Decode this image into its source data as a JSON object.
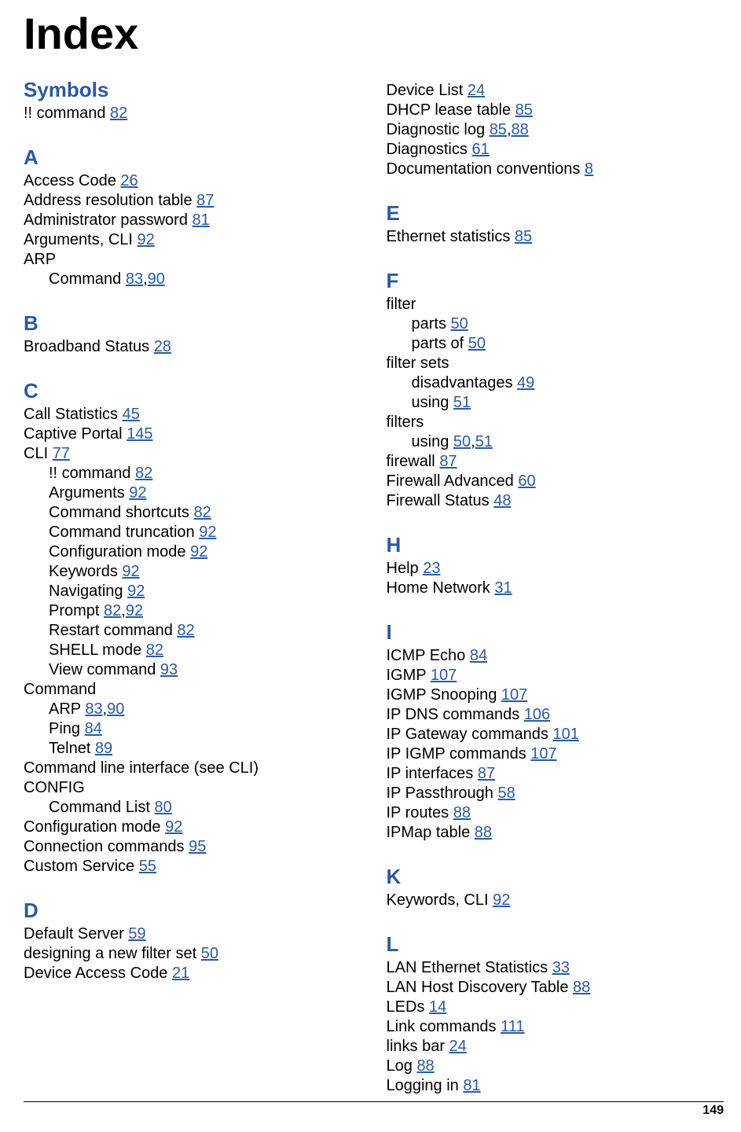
{
  "pageTitle": "Index",
  "pageNumber": "149",
  "columns": [
    [
      {
        "letter": "Symbols",
        "entries": [
          {
            "level": "top",
            "term": "!! command",
            "pages": [
              "82"
            ]
          }
        ]
      },
      {
        "letter": "A",
        "entries": [
          {
            "level": "top",
            "term": "Access Code",
            "pages": [
              "26"
            ]
          },
          {
            "level": "top",
            "term": "Address resolution table",
            "pages": [
              "87"
            ]
          },
          {
            "level": "top",
            "term": "Administrator password",
            "pages": [
              "81"
            ]
          },
          {
            "level": "top",
            "term": "Arguments, CLI",
            "pages": [
              "92"
            ]
          },
          {
            "level": "top",
            "term": "ARP",
            "pages": []
          },
          {
            "level": "sub",
            "term": "Command",
            "pages": [
              "83",
              "90"
            ]
          }
        ]
      },
      {
        "letter": "B",
        "entries": [
          {
            "level": "top",
            "term": "Broadband Status",
            "pages": [
              "28"
            ]
          }
        ]
      },
      {
        "letter": "C",
        "entries": [
          {
            "level": "top",
            "term": "Call Statistics",
            "pages": [
              "45"
            ]
          },
          {
            "level": "top",
            "term": "Captive Portal",
            "pages": [
              "145"
            ]
          },
          {
            "level": "top",
            "term": "CLI",
            "pages": [
              "77"
            ]
          },
          {
            "level": "sub",
            "term": "!! command",
            "pages": [
              "82"
            ]
          },
          {
            "level": "sub",
            "term": "Arguments",
            "pages": [
              "92"
            ]
          },
          {
            "level": "sub",
            "term": "Command shortcuts",
            "pages": [
              "82"
            ]
          },
          {
            "level": "sub",
            "term": "Command truncation",
            "pages": [
              "92"
            ]
          },
          {
            "level": "sub",
            "term": "Configuration mode",
            "pages": [
              "92"
            ]
          },
          {
            "level": "sub",
            "term": "Keywords",
            "pages": [
              "92"
            ]
          },
          {
            "level": "sub",
            "term": "Navigating",
            "pages": [
              "92"
            ]
          },
          {
            "level": "sub",
            "term": "Prompt",
            "pages": [
              "82",
              "92"
            ]
          },
          {
            "level": "sub",
            "term": "Restart command",
            "pages": [
              "82"
            ]
          },
          {
            "level": "sub",
            "term": "SHELL mode",
            "pages": [
              "82"
            ]
          },
          {
            "level": "sub",
            "term": "View command",
            "pages": [
              "93"
            ]
          },
          {
            "level": "top",
            "term": "Command",
            "pages": []
          },
          {
            "level": "sub",
            "term": "ARP",
            "pages": [
              "83",
              "90"
            ]
          },
          {
            "level": "sub",
            "term": "Ping",
            "pages": [
              "84"
            ]
          },
          {
            "level": "sub",
            "term": "Telnet",
            "pages": [
              "89"
            ]
          },
          {
            "level": "top",
            "term": "Command line interface (see CLI)",
            "pages": []
          },
          {
            "level": "top",
            "term": "CONFIG",
            "pages": []
          },
          {
            "level": "sub",
            "term": "Command List",
            "pages": [
              "80"
            ]
          },
          {
            "level": "top",
            "term": "Configuration mode",
            "pages": [
              "92"
            ]
          },
          {
            "level": "top",
            "term": "Connection commands",
            "pages": [
              "95"
            ]
          },
          {
            "level": "top",
            "term": "Custom Service",
            "pages": [
              "55"
            ]
          }
        ]
      },
      {
        "letter": "D",
        "entries": [
          {
            "level": "top",
            "term": "Default Server",
            "pages": [
              "59"
            ]
          },
          {
            "level": "top",
            "term": "designing a new filter set",
            "pages": [
              "50"
            ]
          },
          {
            "level": "top",
            "term": "Device Access Code",
            "pages": [
              "21"
            ]
          }
        ]
      }
    ],
    [
      {
        "letter": "",
        "entries": [
          {
            "level": "top",
            "term": "Device List",
            "pages": [
              "24"
            ]
          },
          {
            "level": "top",
            "term": "DHCP lease table",
            "pages": [
              "85"
            ]
          },
          {
            "level": "top",
            "term": "Diagnostic log",
            "pages": [
              "85",
              "88"
            ]
          },
          {
            "level": "top",
            "term": "Diagnostics",
            "pages": [
              "61"
            ]
          },
          {
            "level": "top",
            "term": "Documentation conventions",
            "pages": [
              "8"
            ]
          }
        ]
      },
      {
        "letter": "E",
        "entries": [
          {
            "level": "top",
            "term": "Ethernet statistics",
            "pages": [
              "85"
            ]
          }
        ]
      },
      {
        "letter": "F",
        "entries": [
          {
            "level": "top",
            "term": "filter",
            "pages": []
          },
          {
            "level": "sub",
            "term": "parts",
            "pages": [
              "50"
            ]
          },
          {
            "level": "sub",
            "term": "parts of",
            "pages": [
              "50"
            ]
          },
          {
            "level": "top",
            "term": "filter sets",
            "pages": []
          },
          {
            "level": "sub",
            "term": "disadvantages",
            "pages": [
              "49"
            ]
          },
          {
            "level": "sub",
            "term": "using",
            "pages": [
              "51"
            ]
          },
          {
            "level": "top",
            "term": "filters",
            "pages": []
          },
          {
            "level": "sub",
            "term": "using",
            "pages": [
              "50",
              "51"
            ]
          },
          {
            "level": "top",
            "term": "firewall",
            "pages": [
              "87"
            ]
          },
          {
            "level": "top",
            "term": "Firewall Advanced",
            "pages": [
              "60"
            ]
          },
          {
            "level": "top",
            "term": "Firewall Status",
            "pages": [
              "48"
            ]
          }
        ]
      },
      {
        "letter": "H",
        "entries": [
          {
            "level": "top",
            "term": "Help",
            "pages": [
              "23"
            ]
          },
          {
            "level": "top",
            "term": "Home Network",
            "pages": [
              "31"
            ]
          }
        ]
      },
      {
        "letter": "I",
        "entries": [
          {
            "level": "top",
            "term": "ICMP Echo",
            "pages": [
              "84"
            ]
          },
          {
            "level": "top",
            "term": "IGMP",
            "pages": [
              "107"
            ]
          },
          {
            "level": "top",
            "term": "IGMP Snooping",
            "pages": [
              "107"
            ]
          },
          {
            "level": "top",
            "term": "IP DNS commands",
            "pages": [
              "106"
            ]
          },
          {
            "level": "top",
            "term": "IP Gateway commands",
            "pages": [
              "101"
            ]
          },
          {
            "level": "top",
            "term": "IP IGMP commands",
            "pages": [
              "107"
            ]
          },
          {
            "level": "top",
            "term": "IP interfaces",
            "pages": [
              "87"
            ]
          },
          {
            "level": "top",
            "term": "IP Passthrough",
            "pages": [
              "58"
            ]
          },
          {
            "level": "top",
            "term": "IP routes",
            "pages": [
              "88"
            ]
          },
          {
            "level": "top",
            "term": "IPMap table",
            "pages": [
              "88"
            ]
          }
        ]
      },
      {
        "letter": "K",
        "entries": [
          {
            "level": "top",
            "term": "Keywords, CLI",
            "pages": [
              "92"
            ]
          }
        ]
      },
      {
        "letter": "L",
        "entries": [
          {
            "level": "top",
            "term": "LAN Ethernet Statistics",
            "pages": [
              "33"
            ]
          },
          {
            "level": "top",
            "term": "LAN Host Discovery Table",
            "pages": [
              "88"
            ]
          },
          {
            "level": "top",
            "term": "LEDs",
            "pages": [
              "14"
            ]
          },
          {
            "level": "top",
            "term": "Link commands",
            "pages": [
              "111"
            ]
          },
          {
            "level": "top",
            "term": "links bar",
            "pages": [
              "24"
            ]
          },
          {
            "level": "top",
            "term": "Log",
            "pages": [
              "88"
            ]
          },
          {
            "level": "top",
            "term": "Logging in",
            "pages": [
              "81"
            ]
          }
        ]
      }
    ]
  ]
}
